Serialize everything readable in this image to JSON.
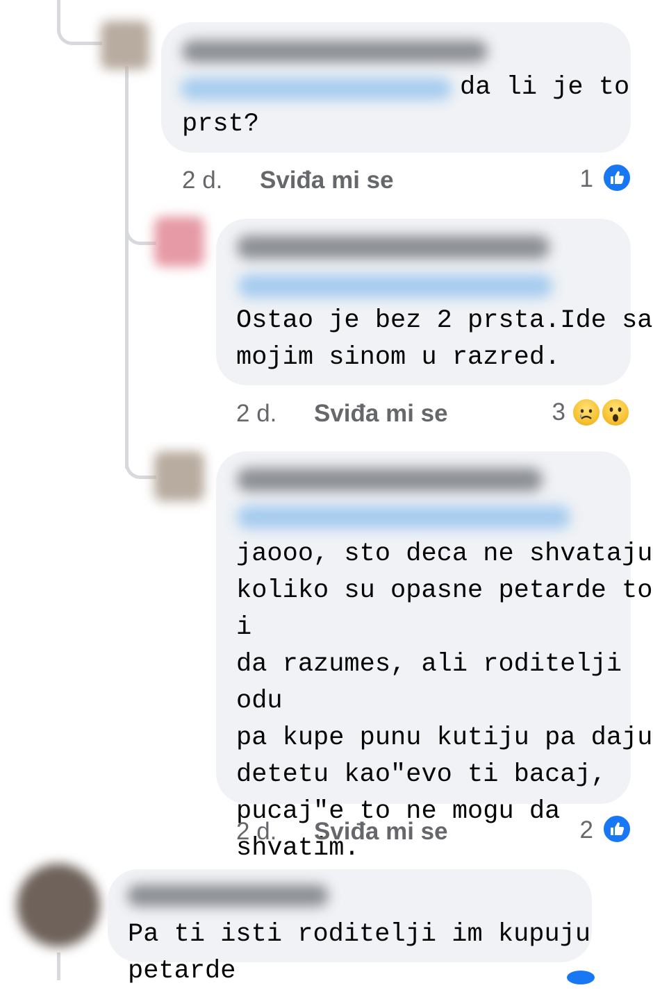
{
  "colors": {
    "bubble": "#f0f2f5",
    "meta_text": "#65676b",
    "like_blue": "#1877f2",
    "reaction_yellow": "#f7c233",
    "thread_line": "#d7d9dd"
  },
  "comments": [
    {
      "author": "",
      "mention": "",
      "text": "da li je to\nprst?",
      "time": "2 d.",
      "like_label": "Sviđa mi se",
      "reaction_count": "1",
      "reaction_icons": [
        "like-icon"
      ]
    },
    {
      "author": "",
      "mention": "",
      "text": "Ostao je bez 2 prsta.Ide sa\nmojim sinom u razred.",
      "time": "2 d.",
      "like_label": "Sviđa mi se",
      "reaction_count": "3",
      "reaction_icons": [
        "sad-icon",
        "wow-icon"
      ]
    },
    {
      "author": "",
      "mention": "",
      "text": "jaooo, sto deca ne shvataju\nkoliko su opasne petarde to i\nda razumes, ali roditelji odu\npa kupe punu kutiju pa daju\ndetetu kao\"evo ti bacaj,\npucaj\"e to ne mogu da\nshvatim.",
      "time": "2 d.",
      "like_label": "Sviđa mi se",
      "reaction_count": "2",
      "reaction_icons": [
        "like-icon"
      ]
    },
    {
      "author": "",
      "text": "Pa ti isti roditelji im kupuju petarde"
    }
  ]
}
